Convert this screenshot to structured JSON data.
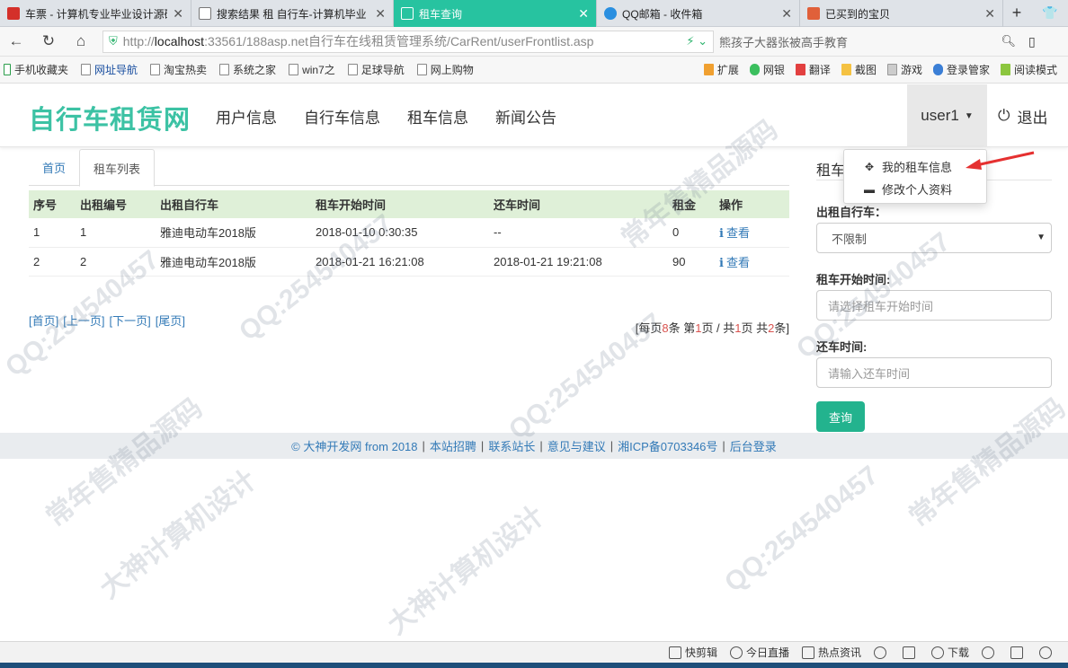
{
  "browser": {
    "tabs": [
      {
        "label": "车票 - 计算机专业毕业设计源码",
        "active": false,
        "icon_color": "#d4302a"
      },
      {
        "label": "搜索结果 租 自行车-计算机毕业",
        "active": false,
        "icon_color": "#ffffff"
      },
      {
        "label": "租车查询",
        "active": true,
        "icon_color": "#ffffff"
      },
      {
        "label": "QQ邮箱 - 收件箱",
        "active": false,
        "icon_color": "#2a8fe0"
      },
      {
        "label": "已买到的宝贝",
        "active": false,
        "icon_color": "#e0603a"
      }
    ],
    "new_tab_label": "+",
    "url_scheme": "http://",
    "url_host": "localhost",
    "url_rest": ":33561/188asp.net自行车在线租赁管理系统/CarRent/userFrontlist.asp",
    "search_placeholder": "熊孩子大器张被高手教育",
    "bookmarks": [
      {
        "label": "手机收藏夹"
      },
      {
        "label": "网址导航"
      },
      {
        "label": "淘宝热卖"
      },
      {
        "label": "系统之家"
      },
      {
        "label": "win7之"
      },
      {
        "label": "足球导航"
      },
      {
        "label": "网上购物"
      }
    ],
    "toolbar_right": [
      {
        "label": "扩展"
      },
      {
        "label": "网银"
      },
      {
        "label": "翻译"
      },
      {
        "label": "截图"
      },
      {
        "label": "游戏"
      },
      {
        "label": "登录管家"
      },
      {
        "label": "阅读模式"
      }
    ],
    "status_items": [
      {
        "label": "快剪辑"
      },
      {
        "label": "今日直播"
      },
      {
        "label": "热点资讯"
      },
      {
        "label": ""
      },
      {
        "label": ""
      },
      {
        "label": "下载"
      },
      {
        "label": ""
      },
      {
        "label": ""
      },
      {
        "label": ""
      }
    ]
  },
  "site": {
    "brand": "自行车租赁网",
    "nav": [
      "用户信息",
      "自行车信息",
      "租车信息",
      "新闻公告"
    ],
    "user": "user1",
    "logout": "退出",
    "dropdown": [
      "我的租车信息",
      "修改个人资料"
    ]
  },
  "content": {
    "tabs": [
      "首页",
      "租车列表"
    ],
    "table": {
      "headers": [
        "序号",
        "出租编号",
        "出租自行车",
        "租车开始时间",
        "还车时间",
        "租金",
        "操作"
      ],
      "rows": [
        [
          "1",
          "1",
          "雅迪电动车2018版",
          "2018-01-10 0:30:35",
          "--",
          "0",
          "查看"
        ],
        [
          "2",
          "2",
          "雅迪电动车2018版",
          "2018-01-21 16:21:08",
          "2018-01-21 19:21:08",
          "90",
          "查看"
        ]
      ]
    },
    "pager_links": [
      "[首页]",
      "[上一页]",
      "[下一页]",
      "[尾页]"
    ],
    "pager_info": {
      "prefix": "[每页",
      "per_page": "8",
      "mid1": "条 第",
      "page": "1",
      "mid2": "页 / 共",
      "pages": "1",
      "mid3": "页 共",
      "total": "2",
      "suffix": "条]"
    }
  },
  "search": {
    "title": "租车",
    "bike_label": "出租自行车：",
    "bike_value": "不限制",
    "start_label": "租车开始时间:",
    "start_placeholder": "请选择租车开始时间",
    "return_label": "还车时间:",
    "return_placeholder": "请输入还车时间",
    "button": "查询"
  },
  "footer": {
    "copyright": "© 大神开发网 from 2018",
    "links": [
      "本站招聘",
      "联系站长",
      "意见与建议",
      "湘ICP备0703346号",
      "后台登录"
    ]
  },
  "watermarks": [
    "QQ:254540457",
    "大神计算机设计",
    "常年售精品源码"
  ],
  "colors": {
    "accent": "#3cc2a4",
    "active_tab": "#27c3a0",
    "button": "#23b38e",
    "table_head": "#dff0d8"
  }
}
